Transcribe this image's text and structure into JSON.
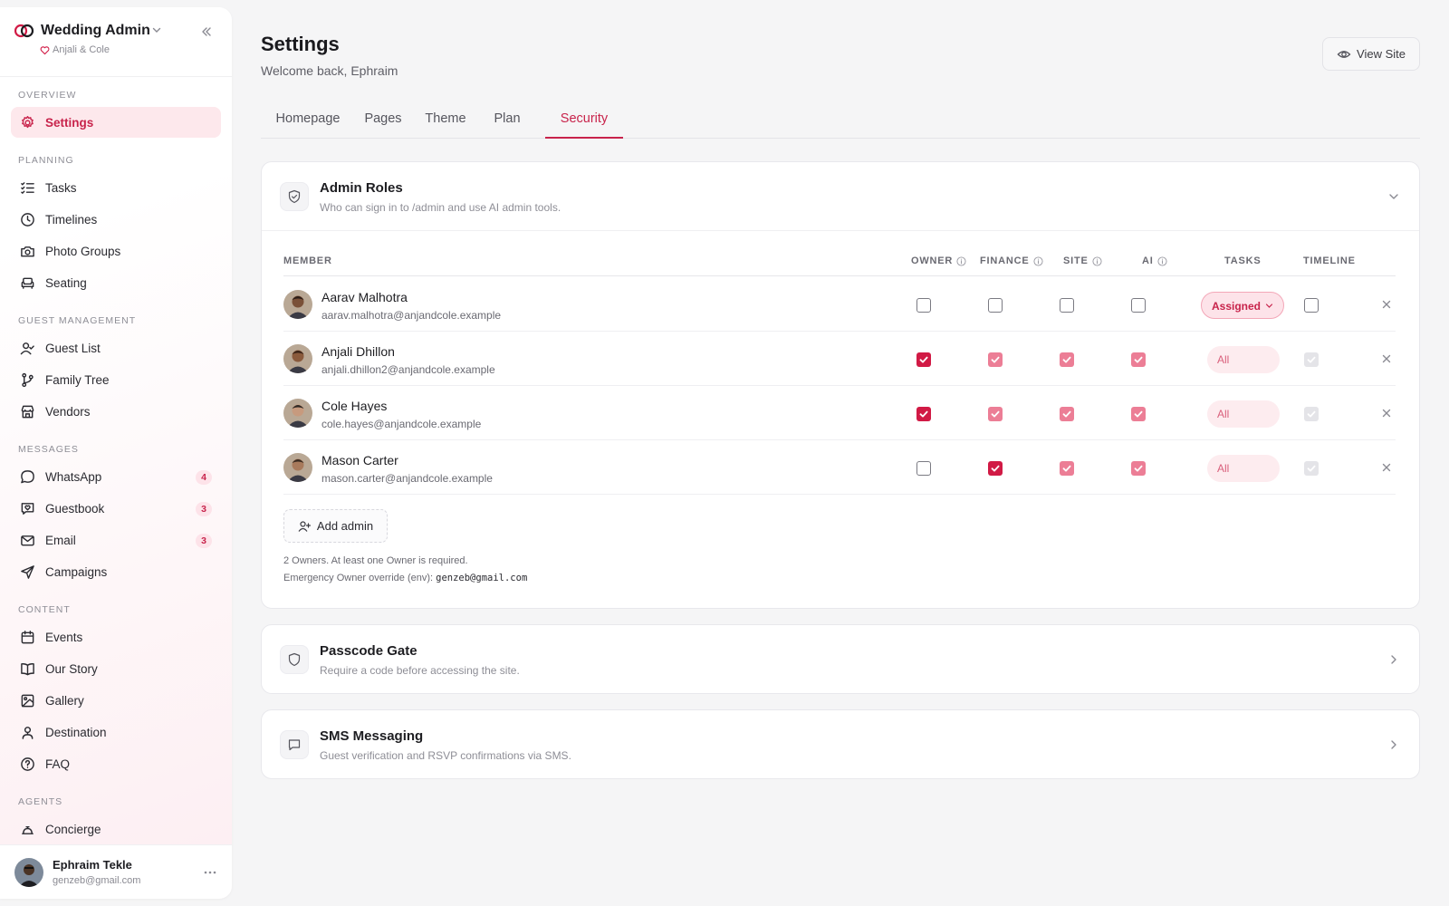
{
  "sidebar": {
    "brand_title": "Wedding Admin",
    "brand_sub": "Anjali & Cole",
    "sections": [
      {
        "label": "Overview",
        "items": [
          {
            "label": "Settings",
            "icon": "gear-icon",
            "active": true
          }
        ]
      },
      {
        "label": "Planning",
        "items": [
          {
            "label": "Tasks",
            "icon": "task-list-icon"
          },
          {
            "label": "Timelines",
            "icon": "clock-icon"
          },
          {
            "label": "Photo Groups",
            "icon": "camera-icon"
          },
          {
            "label": "Seating",
            "icon": "armchair-icon"
          }
        ]
      },
      {
        "label": "Guest Management",
        "items": [
          {
            "label": "Guest List",
            "icon": "user-check-icon"
          },
          {
            "label": "Family Tree",
            "icon": "git-branch-icon"
          },
          {
            "label": "Vendors",
            "icon": "store-icon"
          }
        ]
      },
      {
        "label": "Messages",
        "items": [
          {
            "label": "WhatsApp",
            "icon": "chat-bubble-icon",
            "badge": "4"
          },
          {
            "label": "Guestbook",
            "icon": "heart-message-icon",
            "badge": "3"
          },
          {
            "label": "Email",
            "icon": "mail-icon",
            "badge": "3"
          },
          {
            "label": "Campaigns",
            "icon": "send-icon"
          }
        ]
      },
      {
        "label": "Content",
        "items": [
          {
            "label": "Events",
            "icon": "calendar-icon"
          },
          {
            "label": "Our Story",
            "icon": "book-icon"
          },
          {
            "label": "Gallery",
            "icon": "image-icon"
          },
          {
            "label": "Destination",
            "icon": "map-pin-icon"
          },
          {
            "label": "FAQ",
            "icon": "help-circle-icon"
          }
        ]
      },
      {
        "label": "Agents",
        "items": [
          {
            "label": "Concierge",
            "icon": "concierge-icon"
          }
        ]
      }
    ],
    "user": {
      "name": "Ephraim Tekle",
      "email": "genzeb@gmail.com"
    }
  },
  "header": {
    "title": "Settings",
    "subtitle": "Welcome back, Ephraim",
    "view_site_label": "View Site"
  },
  "tabs": [
    {
      "label": "Homepage",
      "active": false
    },
    {
      "label": "Pages",
      "active": false
    },
    {
      "label": "Theme",
      "active": false
    },
    {
      "label": "Plan",
      "active": false
    },
    {
      "label": "Security",
      "active": true
    }
  ],
  "admin_roles": {
    "title": "Admin Roles",
    "subtitle": "Who can sign in to /admin and use AI admin tools.",
    "columns": {
      "member": "Member",
      "owner": "Owner",
      "finance": "Finance",
      "site": "Site",
      "ai": "AI",
      "tasks": "Tasks",
      "timeline": "Timeline"
    },
    "members": [
      {
        "name": "Aarav Malhotra",
        "email": "aarav.malhotra@anjandcole.example",
        "owner": "off",
        "finance": "off",
        "site": "off",
        "ai": "off",
        "tasks": "Assigned",
        "timeline": "off"
      },
      {
        "name": "Anjali Dhillon",
        "email": "anjali.dhillon2@anjandcole.example",
        "owner": "on",
        "finance": "inherited",
        "site": "inherited",
        "ai": "inherited",
        "tasks": "All",
        "timeline": "disabled"
      },
      {
        "name": "Cole Hayes",
        "email": "cole.hayes@anjandcole.example",
        "owner": "on",
        "finance": "inherited",
        "site": "inherited",
        "ai": "inherited",
        "tasks": "All",
        "timeline": "disabled"
      },
      {
        "name": "Mason Carter",
        "email": "mason.carter@anjandcole.example",
        "owner": "off",
        "finance": "on",
        "site": "inherited",
        "ai": "inherited",
        "tasks": "All",
        "timeline": "disabled"
      }
    ],
    "add_admin_label": "Add admin",
    "owners_note": "2 Owners. At least one Owner is required.",
    "override_label": "Emergency Owner override (env): ",
    "override_email": "genzeb@gmail.com"
  },
  "passcode_gate": {
    "title": "Passcode Gate",
    "subtitle": "Require a code before accessing the site."
  },
  "sms_messaging": {
    "title": "SMS Messaging",
    "subtitle": "Guest verification and RSVP confirmations via SMS."
  },
  "colors": {
    "accent": "#c8234b",
    "accent_bg": "#fde8ec",
    "checked": "#d11a45",
    "inherited": "#ec7e96"
  }
}
